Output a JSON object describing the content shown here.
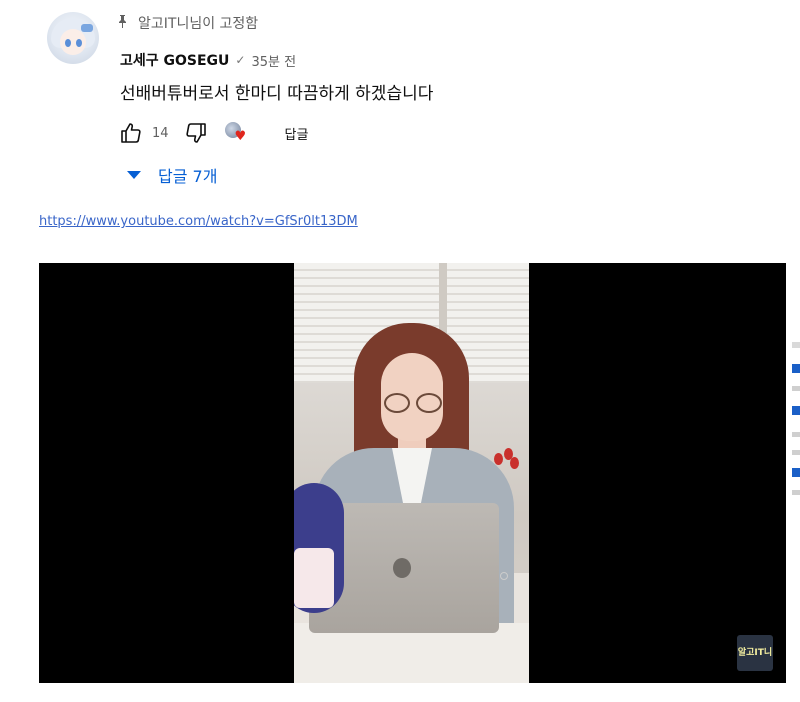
{
  "comment": {
    "pinned_label": "알고IT니님이 고정함",
    "author": "고세구 GOSEGU",
    "time": "35분 전",
    "text": "선배버튜버로서 한마디 따끔하게 하겠습니다",
    "like_count": "14",
    "reply_label": "답글",
    "replies_toggle": "답글 7개"
  },
  "post": {
    "link": "https://www.youtube.com/watch?v=GfSr0lt13DM"
  },
  "video": {
    "channel_badge": "알고IT니"
  },
  "colors": {
    "link_blue": "#3a66c9",
    "reply_blue": "#065fd4",
    "heart_red": "#e0261d",
    "meta_gray": "#606060"
  }
}
